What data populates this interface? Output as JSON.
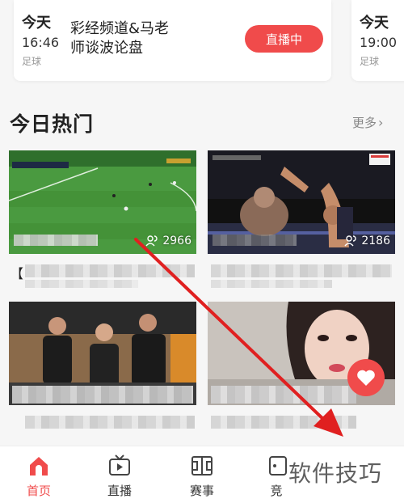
{
  "schedule": [
    {
      "day": "今天",
      "time": "16:46",
      "sport": "足球",
      "title": "彩经频道&马老师谈波论盘",
      "button": "直播中"
    },
    {
      "day": "今天",
      "time": "19:00",
      "sport": "足球"
    }
  ],
  "section": {
    "title": "今日热门",
    "more": "更多"
  },
  "cards": [
    {
      "viewers": "2966",
      "prefix": "【"
    },
    {
      "viewers": "2186"
    },
    {
      "prefix": ""
    },
    {
      "prefix": ""
    }
  ],
  "nav": [
    {
      "label": "首页",
      "icon": "home-icon",
      "active": true
    },
    {
      "label": "直播",
      "icon": "tv-icon"
    },
    {
      "label": "赛事",
      "icon": "match-field-icon"
    },
    {
      "label": "竞",
      "icon": "guess-icon"
    }
  ],
  "watermark": "软件技巧",
  "colors": {
    "accent": "#f04b4b",
    "background": "#f6f6f6"
  }
}
